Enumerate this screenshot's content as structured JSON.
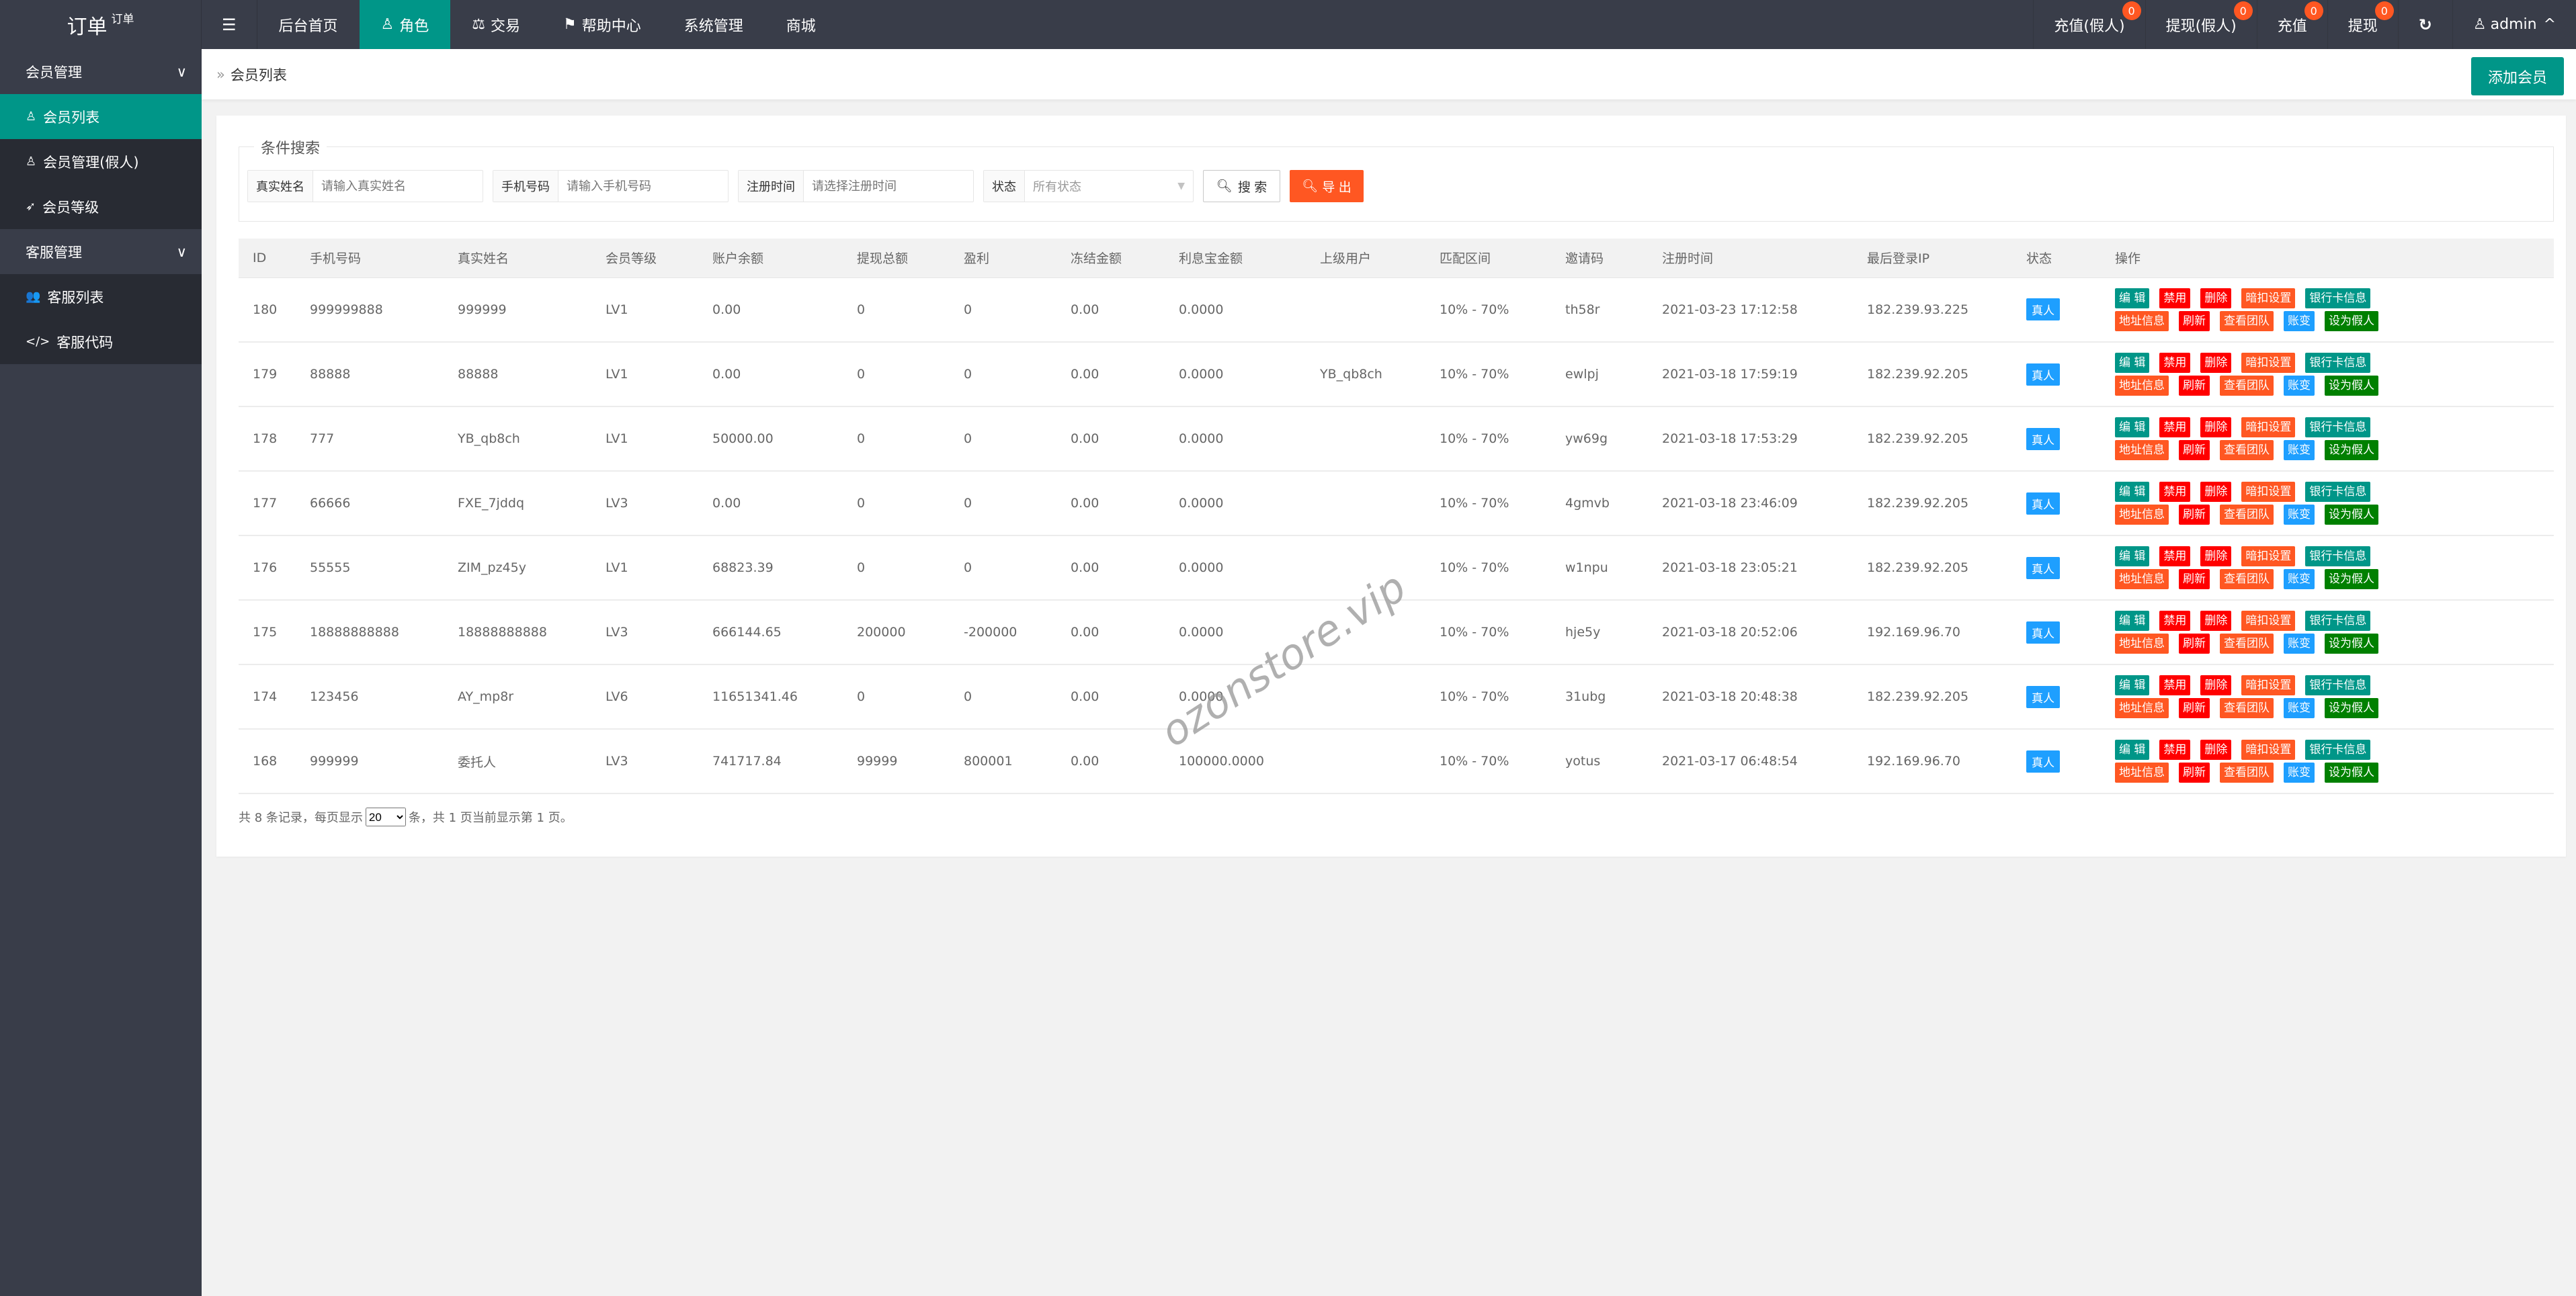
{
  "logo": {
    "title": "订单",
    "sup": "订单"
  },
  "nav": {
    "menu_icon": "menu-icon",
    "items": [
      {
        "label": "后台首页",
        "icon": ""
      },
      {
        "label": "角色",
        "icon": "user-icon",
        "active": true
      },
      {
        "label": "交易",
        "icon": "scale-icon"
      },
      {
        "label": "帮助中心",
        "icon": "flag-icon"
      },
      {
        "label": "系统管理",
        "icon": ""
      },
      {
        "label": "商城",
        "icon": ""
      }
    ]
  },
  "right_nav": [
    {
      "label": "充值(假人)",
      "badge": "0"
    },
    {
      "label": "提现(假人)",
      "badge": "0"
    },
    {
      "label": "充值",
      "badge": "0"
    },
    {
      "label": "提现",
      "badge": "0"
    }
  ],
  "user": {
    "name": "admin"
  },
  "sidebar": {
    "group1": "会员管理",
    "items1": [
      "会员列表",
      "会员管理(假人)",
      "会员等级"
    ],
    "group2": "客服管理",
    "items2": [
      "客服列表",
      "客服代码"
    ]
  },
  "breadcrumb": "会员列表",
  "add_button": "添加会员",
  "search": {
    "legend": "条件搜索",
    "name_label": "真实姓名",
    "name_placeholder": "请输入真实姓名",
    "phone_label": "手机号码",
    "phone_placeholder": "请输入手机号码",
    "time_label": "注册时间",
    "time_placeholder": "请选择注册时间",
    "status_label": "状态",
    "status_value": "所有状态",
    "search_button": "搜 索",
    "export_button": "导 出"
  },
  "table": {
    "headers": [
      "ID",
      "手机号码",
      "真实姓名",
      "会员等级",
      "账户余额",
      "提现总额",
      "盈利",
      "冻结金额",
      "利息宝金额",
      "上级用户",
      "匹配区间",
      "邀请码",
      "注册时间",
      "最后登录IP",
      "状态",
      "操作"
    ],
    "rows": [
      [
        "180",
        "999999888",
        "999999",
        "LV1",
        "0.00",
        "0",
        "0",
        "0.00",
        "0.0000",
        "",
        "10% - 70%",
        "th58r",
        "2021-03-23 17:12:58",
        "182.239.93.225",
        "真人"
      ],
      [
        "179",
        "88888",
        "88888",
        "LV1",
        "0.00",
        "0",
        "0",
        "0.00",
        "0.0000",
        "YB_qb8ch",
        "10% - 70%",
        "ewlpj",
        "2021-03-18 17:59:19",
        "182.239.92.205",
        "真人"
      ],
      [
        "178",
        "777",
        "YB_qb8ch",
        "LV1",
        "50000.00",
        "0",
        "0",
        "0.00",
        "0.0000",
        "",
        "10% - 70%",
        "yw69g",
        "2021-03-18 17:53:29",
        "182.239.92.205",
        "真人"
      ],
      [
        "177",
        "66666",
        "FXE_7jddq",
        "LV3",
        "0.00",
        "0",
        "0",
        "0.00",
        "0.0000",
        "",
        "10% - 70%",
        "4gmvb",
        "2021-03-18 23:46:09",
        "182.239.92.205",
        "真人"
      ],
      [
        "176",
        "55555",
        "ZIM_pz45y",
        "LV1",
        "68823.39",
        "0",
        "0",
        "0.00",
        "0.0000",
        "",
        "10% - 70%",
        "w1npu",
        "2021-03-18 23:05:21",
        "182.239.92.205",
        "真人"
      ],
      [
        "175",
        "18888888888",
        "18888888888",
        "LV3",
        "666144.65",
        "200000",
        "-200000",
        "0.00",
        "0.0000",
        "",
        "10% - 70%",
        "hje5y",
        "2021-03-18 20:52:06",
        "192.169.96.70",
        "真人"
      ],
      [
        "174",
        "123456",
        "AY_mp8r",
        "LV6",
        "11651341.46",
        "0",
        "0",
        "0.00",
        "0.0000",
        "",
        "10% - 70%",
        "31ubg",
        "2021-03-18 20:48:38",
        "182.239.92.205",
        "真人"
      ],
      [
        "168",
        "999999",
        "委托人",
        "LV3",
        "741717.84",
        "99999",
        "800001",
        "0.00",
        "100000.0000",
        "",
        "10% - 70%",
        "yotus",
        "2021-03-17 06:48:54",
        "192.169.96.70",
        "真人"
      ]
    ],
    "actions": [
      {
        "label": "编 辑",
        "color": "#009688"
      },
      {
        "label": "禁用",
        "color": "#ff0000"
      },
      {
        "label": "删除",
        "color": "#ff0000"
      },
      {
        "label": "暗扣设置",
        "color": "#ff5722"
      },
      {
        "label": "银行卡信息",
        "color": "#009688"
      },
      {
        "label": "地址信息",
        "color": "#ff5722"
      },
      {
        "label": "刷新",
        "color": "#ff0000"
      },
      {
        "label": "查看团队",
        "color": "#ff5722"
      },
      {
        "label": "账变",
        "color": "#1e9fff"
      },
      {
        "label": "设为假人",
        "color": "#008000"
      }
    ]
  },
  "footer": {
    "prefix": "共 8 条记录，每页显示",
    "page_size": "20",
    "suffix": "条，共 1 页当前显示第 1 页。"
  },
  "watermark": "ozonstore.vip"
}
